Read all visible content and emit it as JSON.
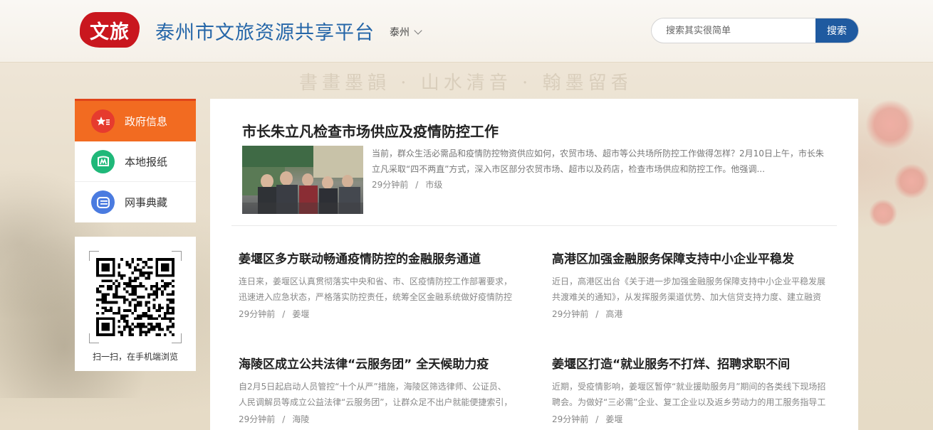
{
  "header": {
    "logo_text": "文旅",
    "site_title": "泰州市文旅资源共享平台",
    "city": "泰州",
    "search_placeholder": "搜索其实很简单",
    "search_button": "搜索"
  },
  "sidebar": {
    "items": [
      {
        "label": "政府信息",
        "icon": "star-badge-icon",
        "active": true
      },
      {
        "label": "本地报纸",
        "icon": "newspaper-icon",
        "active": false
      },
      {
        "label": "网事典藏",
        "icon": "archive-icon",
        "active": false
      }
    ]
  },
  "qr": {
    "caption": "扫一扫，在手机端浏览"
  },
  "featured": {
    "title": "市长朱立凡检查市场供应及疫情防控工作",
    "summary": "当前，群众生活必需品和疫情防控物资供应如何，农贸市场、超市等公共场所防控工作做得怎样？2月10日上午，市长朱立凡采取“四不两直”方式，深入市区部分农贸市场、超市以及药店，检查市场供应和防控工作。他强调...",
    "time": "29分钟前",
    "category": "市级"
  },
  "articles": [
    {
      "title": "姜堰区多方联动畅通疫情防控的金融服务通道",
      "summary": "连日来，姜堰区认真贯彻落实中央和省、市、区疫情防控工作部署要求，迅速进入应急状态，严格落实防控责任，统筹全区金融系统做好疫情防控",
      "time": "29分钟前",
      "category": "姜堰"
    },
    {
      "title": "高港区加强金融服务保障支持中小企业平稳发",
      "summary": "近日，高港区出台《关于进一步加强金融服务保障支持中小企业平稳发展共渡难关的通知》，从发挥服务渠道优势、加大信贷支持力度、建立融资",
      "time": "29分钟前",
      "category": "高港"
    },
    {
      "title": "海陵区成立公共法律“云服务团” 全天候助力疫",
      "summary": "自2月5日起启动人员管控“十个从严”措施，海陵区筛选律师、公证员、人民调解员等成立公益法律“云服务团”，让群众足不出户就能便捷索引，为",
      "time": "29分钟前",
      "category": "海陵"
    },
    {
      "title": "姜堰区打造“就业服务不打烊、招聘求职不间",
      "summary": "近期，受疫情影响，姜堰区暂停“就业援助服务月”期间的各类线下现场招聘会。为做好“三必需”企业、复工企业以及返乡劳动力的用工服务指导工",
      "time": "29分钟前",
      "category": "姜堰"
    }
  ],
  "meta_separator": "/",
  "colors": {
    "brand_blue": "#2566a8",
    "search_blue": "#1f5aa0",
    "active_orange": "#f26b21",
    "logo_red": "#c9171e"
  }
}
